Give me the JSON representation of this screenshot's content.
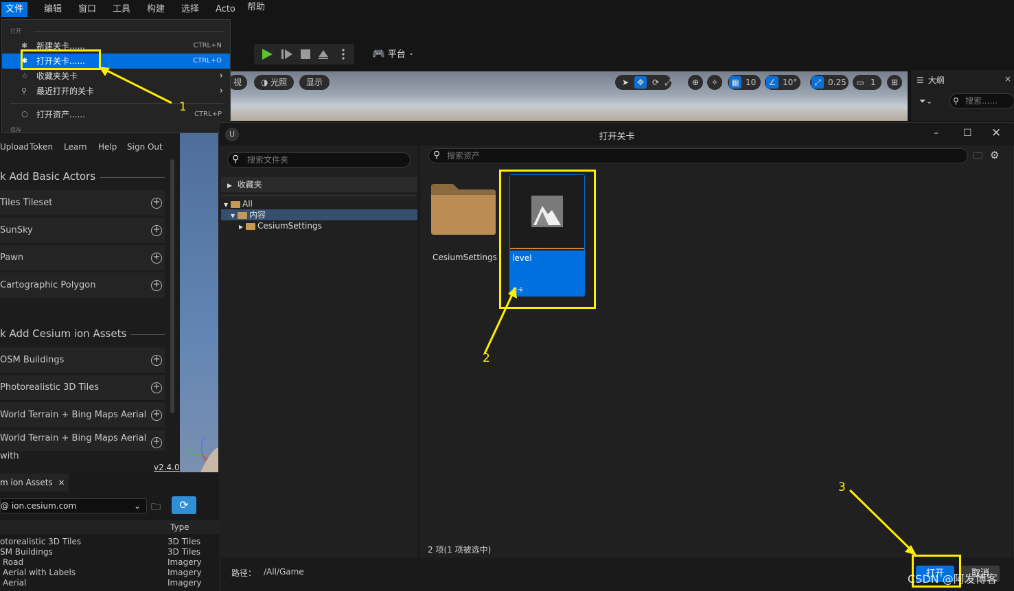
{
  "menubar": {
    "items": [
      "文件",
      "编辑",
      "窗口",
      "工具",
      "构建",
      "选择",
      "Acto",
      "帮助"
    ]
  },
  "file_menu": {
    "section_open": "打开",
    "section_save": "保存",
    "items": [
      {
        "label": "新建关卡......",
        "shortcut": "CTRL+N"
      },
      {
        "label": "打开关卡......",
        "shortcut": "CTRL+O"
      },
      {
        "label": "收藏夹关卡",
        "arrow": "›"
      },
      {
        "label": "最近打开的关卡",
        "arrow": "›"
      },
      {
        "label": "打开资产......",
        "shortcut": "CTRL+P"
      }
    ]
  },
  "toolbar": {
    "platform_label": "平台"
  },
  "viewport": {
    "pill_view": "视",
    "pill_lighting": "光照",
    "pill_show": "显示",
    "grid_value": "10",
    "angle_value": "10°",
    "scale_value": "0.25",
    "camera_value": "1"
  },
  "outline": {
    "title": "大纲",
    "search_placeholder": "搜索......"
  },
  "left_panel": {
    "toolbar_labels": [
      "Upload",
      "Token",
      "Learn",
      "Help",
      "Sign Out"
    ],
    "quick_add_basic": "k Add Basic Actors",
    "basic_actors": [
      "Tiles Tileset",
      "SunSky",
      "Pawn",
      "Cartographic Polygon"
    ],
    "quick_add_ion": "k Add Cesium ion Assets",
    "ion_assets": [
      "OSM Buildings",
      "Photorealistic 3D Tiles",
      "World Terrain + Bing Maps Aerial",
      "World Terrain + Bing Maps Aerial with"
    ],
    "version": "v2.4.0"
  },
  "assets_panel": {
    "tab_label": "m ion Assets",
    "server": "@ ion.cesium.com",
    "col_type": "Type",
    "rows": [
      {
        "name": "otorealistic 3D Tiles",
        "type": "3D Tiles"
      },
      {
        "name": "SM Buildings",
        "type": "3D Tiles"
      },
      {
        "name": "Road",
        "type": "Imagery"
      },
      {
        "name": "Aerial with Labels",
        "type": "Imagery"
      },
      {
        "name": "Aerial",
        "type": "Imagery"
      }
    ]
  },
  "dialog": {
    "title": "打开关卡",
    "folder_search_placeholder": "搜索文件夹",
    "asset_search_placeholder": "搜索资产",
    "favorites": "收藏夹",
    "tree": [
      "All",
      "内容",
      "CesiumSettings"
    ],
    "assets": [
      {
        "name": "CesiumSettings",
        "kind": "folder"
      },
      {
        "name": "level",
        "kind": "关卡"
      }
    ],
    "status": "2 项(1 项被选中)",
    "path_label": "路径：",
    "path_value": "/All/Game",
    "open_button": "打开",
    "cancel_button": "取消"
  },
  "annotations": [
    "1",
    "2",
    "3"
  ],
  "watermark": "CSDN @阿发博客",
  "colors": {
    "accent_blue": "#0070e0",
    "annotation_yellow": "#ffee00",
    "play_green": "#5ec22e",
    "folder_tan": "#b98d55"
  }
}
